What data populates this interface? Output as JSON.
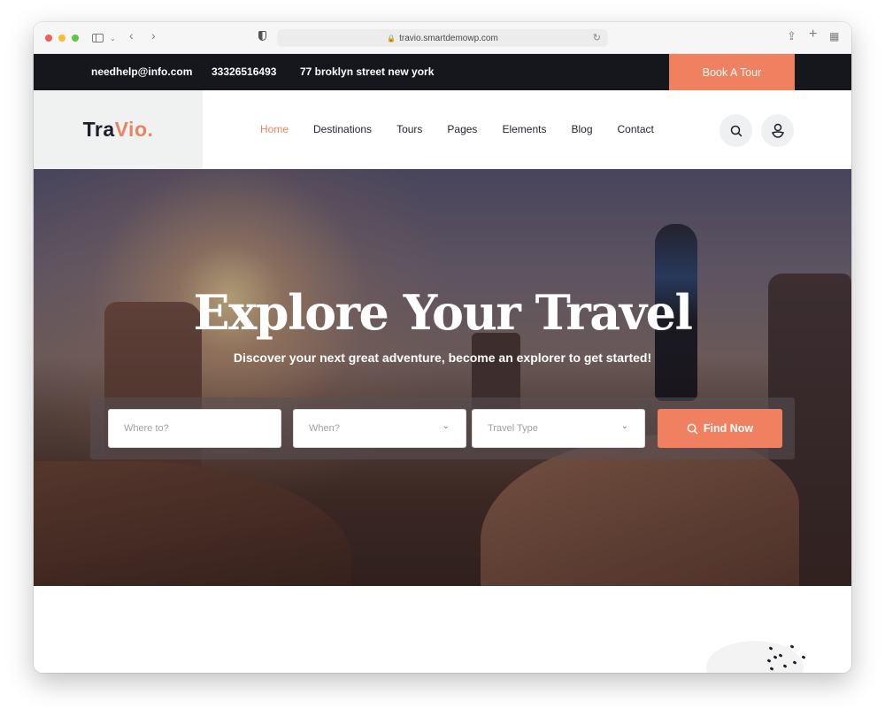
{
  "browser": {
    "url": "travio.smartdemowp.com",
    "traffic_lights": [
      "#ee5f57",
      "#f5bd2f",
      "#5fc63f"
    ]
  },
  "topbar": {
    "email": "needhelp@info.com",
    "phone": "33326516493",
    "address": "77 broklyn street new york",
    "book_label": "Book A Tour"
  },
  "header": {
    "logo_part1": "Tra",
    "logo_part2": "Vio.",
    "nav": [
      {
        "label": "Home",
        "active": true
      },
      {
        "label": "Destinations"
      },
      {
        "label": "Tours"
      },
      {
        "label": "Pages"
      },
      {
        "label": "Elements"
      },
      {
        "label": "Blog"
      },
      {
        "label": "Contact"
      }
    ],
    "icons": [
      "search-icon",
      "user-icon"
    ]
  },
  "hero": {
    "title": "Explore Your Travel",
    "subtitle": "Discover your next great adventure, become an explorer to get started!",
    "search": {
      "where_placeholder": "Where to?",
      "when_placeholder": "When?",
      "type_placeholder": "Travel Type",
      "button_label": "Find Now"
    }
  },
  "colors": {
    "accent": "#ef8160",
    "dark": "#16171c"
  }
}
